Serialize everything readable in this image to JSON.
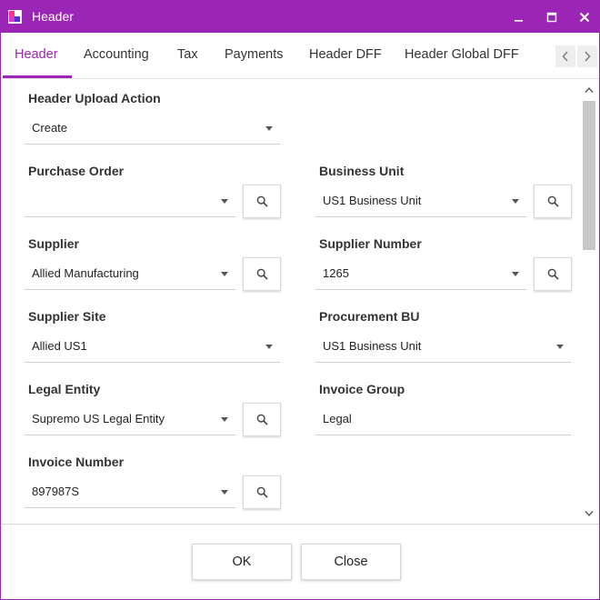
{
  "window": {
    "title": "Header",
    "accent_color": "#9b26b6",
    "controls": [
      "minimize-icon",
      "maximize-icon",
      "close-icon"
    ]
  },
  "tabs": [
    {
      "label": "Header",
      "active": true
    },
    {
      "label": "Accounting",
      "active": false
    },
    {
      "label": "Tax",
      "active": false
    },
    {
      "label": "Payments",
      "active": false
    },
    {
      "label": "Header DFF",
      "active": false
    },
    {
      "label": "Header Global DFF",
      "active": false
    }
  ],
  "form": {
    "header_upload_action": {
      "label": "Header Upload Action",
      "value": "Create"
    },
    "purchase_order": {
      "label": "Purchase Order",
      "value": ""
    },
    "business_unit": {
      "label": "Business Unit",
      "value": "US1 Business Unit"
    },
    "supplier": {
      "label": "Supplier",
      "value": "Allied Manufacturing"
    },
    "supplier_number": {
      "label": "Supplier Number",
      "value": "1265"
    },
    "supplier_site": {
      "label": "Supplier Site",
      "value": "Allied US1"
    },
    "procurement_bu": {
      "label": "Procurement BU",
      "value": "US1 Business Unit"
    },
    "legal_entity": {
      "label": "Legal Entity",
      "value": "Supremo US Legal Entity"
    },
    "invoice_group": {
      "label": "Invoice Group",
      "value": "Legal"
    },
    "invoice_number": {
      "label": "Invoice Number",
      "value": "897987S"
    }
  },
  "footer": {
    "ok_label": "OK",
    "close_label": "Close"
  }
}
